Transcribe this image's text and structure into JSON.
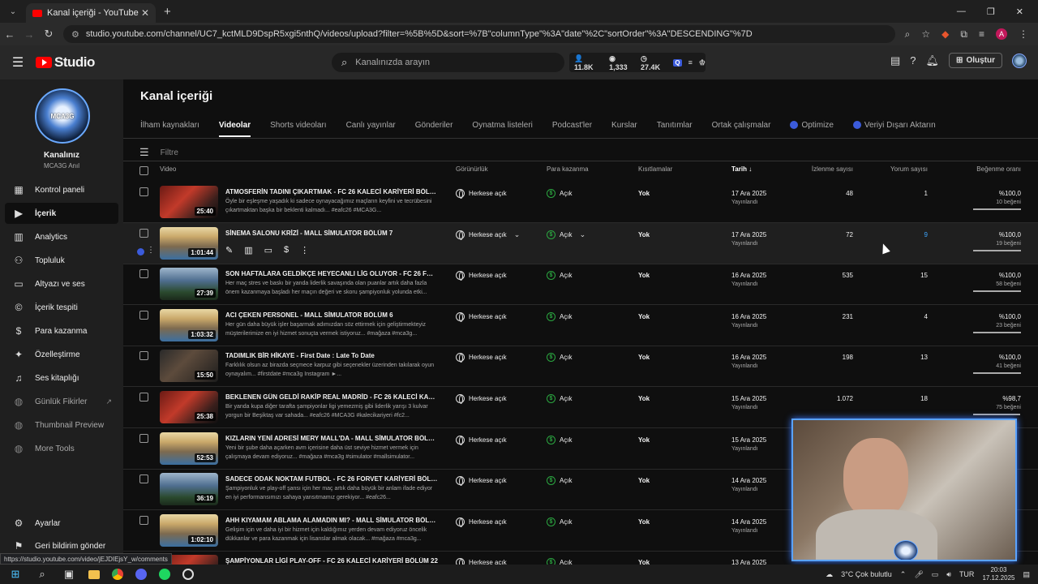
{
  "browser": {
    "tab_title": "Kanal içeriği - YouTube Studio",
    "url": "studio.youtube.com/channel/UC7_kctMLD9DspR5xgi5nthQ/videos/upload?filter=%5B%5D&sort=%7B\"columnType\"%3A\"date\"%2C\"sortOrder\"%3A\"DESCENDING\"%7D",
    "status_url": "https://studio.youtube.com/video/jEJDIEjsY_w/comments",
    "profile_initial": "A"
  },
  "header": {
    "logo_text": "Studio",
    "search_placeholder": "Kanalınızda arayın",
    "stats": {
      "subs": "11.8K",
      "views": "1,333",
      "watch": "27.4K"
    },
    "create_label": "Oluştur"
  },
  "sidebar": {
    "avatar_text": "MCA3G",
    "channel_title": "Kanalınız",
    "channel_name": "MCA3G Anıl",
    "items": [
      {
        "label": "Kontrol paneli",
        "icon": "dashboard-icon"
      },
      {
        "label": "İçerik",
        "icon": "content-icon"
      },
      {
        "label": "Analytics",
        "icon": "analytics-icon"
      },
      {
        "label": "Topluluk",
        "icon": "community-icon"
      },
      {
        "label": "Altyazı ve ses",
        "icon": "subtitles-icon"
      },
      {
        "label": "İçerik tespiti",
        "icon": "copyright-icon"
      },
      {
        "label": "Para kazanma",
        "icon": "dollar-icon"
      },
      {
        "label": "Özelleştirme",
        "icon": "magic-wand-icon"
      },
      {
        "label": "Ses kitaplığı",
        "icon": "audio-library-icon"
      },
      {
        "label": "Günlük Fikirler",
        "icon": "ideas-icon"
      },
      {
        "label": "Thumbnail Preview",
        "icon": "thumbnail-preview-icon"
      },
      {
        "label": "More Tools",
        "icon": "tools-icon"
      },
      {
        "label": "Ayarlar",
        "icon": "gear-icon"
      },
      {
        "label": "Geri bildirim gönder",
        "icon": "feedback-icon"
      }
    ]
  },
  "main": {
    "title": "Kanal içeriği",
    "tabs": [
      "İlham kaynakları",
      "Videolar",
      "Shorts videoları",
      "Canlı yayınlar",
      "Gönderiler",
      "Oynatma listeleri",
      "Podcast'ler",
      "Kurslar",
      "Tanıtımlar",
      "Ortak çalışmalar",
      "Optimize",
      "Veriyi Dışarı Aktarın"
    ],
    "filter_placeholder": "Filtre",
    "columns": {
      "video": "Video",
      "visibility": "Görünürlük",
      "monetization": "Para kazanma",
      "restrictions": "Kısıtlamalar",
      "date": "Tarih",
      "views": "İzlenme sayısı",
      "comments": "Yorum sayısı",
      "likes": "Beğenme oranı"
    },
    "rows": [
      {
        "title": "ATMOSFERİN TADINI ÇIKARTMAK - FC 26 KALECİ KARİYERİ BÖLÜM 24",
        "desc": "Öyle bir eşleşme yaşadık ki sadece oynayacağımız maçların keyfini ve tecrübesini çıkartmaktan başka bir beklenti kalmadı... #eafc26 #MCA3G...",
        "duration": "25:40",
        "visibility": "Herkese açık",
        "monetization": "Açık",
        "restrictions": "Yok",
        "date": "17 Ara 2025",
        "status": "Yayınlandı",
        "views": "48",
        "comments": "1",
        "like_ratio": "%100,0",
        "like_count": "10 beğeni",
        "like_fraction": 1.0,
        "thumb": "football"
      },
      {
        "title": "SİNEMA SALONU KRİZİ - MALL SİMULATOR BÖLÜM 7",
        "desc": "",
        "duration": "1:01:44",
        "visibility": "Herkese açık",
        "monetization": "Açık",
        "restrictions": "Yok",
        "date": "17 Ara 2025",
        "status": "Yayınlandı",
        "views": "72",
        "comments": "9",
        "like_ratio": "%100,0",
        "like_count": "19 beğeni",
        "like_fraction": 1.0,
        "thumb": "mall"
      },
      {
        "title": "SON HAFTALARA GELDİKÇE HEYECANLI LİG OLUYOR - FC 26 FORVET KARİYERİ",
        "desc": "Her maç stres ve baskı bir yanda liderlik savaşında olan puanlar artık daha fazla önem kazanmaya başladı her maçın değeri ve skoru şampiyonluk yolunda etki...",
        "duration": "27:39",
        "visibility": "Herkese açık",
        "monetization": "Açık",
        "restrictions": "Yok",
        "date": "16 Ara 2025",
        "status": "Yayınlandı",
        "views": "535",
        "comments": "15",
        "like_ratio": "%100,0",
        "like_count": "58 beğeni",
        "like_fraction": 1.0,
        "thumb": "stadium"
      },
      {
        "title": "ACI ÇEKEN PERSONEL - MALL SİMULATOR BÖLÜM 6",
        "desc": "Her gün daha büyük işler başarmak adımızdan söz ettirmek için geliştirmekteyiz müşterilerimize en iyi hizmet sonuçta vermek istiyoruz... #mağaza #mca3g...",
        "duration": "1:03:32",
        "visibility": "Herkese açık",
        "monetization": "Açık",
        "restrictions": "Yok",
        "date": "16 Ara 2025",
        "status": "Yayınlandı",
        "views": "231",
        "comments": "4",
        "like_ratio": "%100,0",
        "like_count": "23 beğeni",
        "like_fraction": 1.0,
        "thumb": "mall"
      },
      {
        "title": "TADIMLIK BİR HİKAYE - First Date : Late To Date",
        "desc": "Farklılık olsun az birazda seçmece karpuz gibi seçenekler üzerinden takılarak oyun oynayalım... #firstdate #mca3g Instagram ►...",
        "duration": "15:50",
        "visibility": "Herkese açık",
        "monetization": "Açık",
        "restrictions": "Yok",
        "date": "16 Ara 2025",
        "status": "Yayınlandı",
        "views": "198",
        "comments": "13",
        "like_ratio": "%100,0",
        "like_count": "41 beğeni",
        "like_fraction": 1.0,
        "thumb": "story"
      },
      {
        "title": "BEKLENEN GÜN GELDİ RAKİP REAL MADRİD - FC 26 KALECİ KARİYERİ BÖLÜM",
        "desc": "Bir yanda kupa diğer tarafta şampiyonlar ligi yemezmiş gibi liderlik yarışı 3 kulvar yorgun bir Beşiktaş var sahada... #eafc26 #MCA3G #kalecikariyeri #fc2...",
        "duration": "25:38",
        "visibility": "Herkese açık",
        "monetization": "Açık",
        "restrictions": "Yok",
        "date": "15 Ara 2025",
        "status": "Yayınlandı",
        "views": "1.072",
        "comments": "18",
        "like_ratio": "%98,7",
        "like_count": "75 beğeni",
        "like_fraction": 0.987,
        "thumb": "football"
      },
      {
        "title": "KIZLARIN YENİ ADRESİ MERY MALL'DA - MALL SİMULATOR BÖLÜM 5",
        "desc": "Yeni bir şube daha açarken avm içerisine daha üst seviye hizmet vermek için çalışmaya devam ediyoruz... #mağaza #mca3g #simulator #mallsimulator...",
        "duration": "52:53",
        "visibility": "Herkese açık",
        "monetization": "Açık",
        "restrictions": "Yok",
        "date": "15 Ara 2025",
        "status": "Yayınlandı",
        "views": "",
        "comments": "",
        "like_ratio": "",
        "like_count": "",
        "like_fraction": 0,
        "thumb": "mall"
      },
      {
        "title": "SADECE ODAK NOKTAM FUTBOL - FC 26 FORVET KARİYERİ BÖLÜM 9",
        "desc": "Şampiyonluk ve play-off şansı için her maç artık daha büyük bir anlam ifade ediyor en iyi performansımızı sahaya yansıtmamız gerekiyor... #eafc26...",
        "duration": "36:19",
        "visibility": "Herkese açık",
        "monetization": "Açık",
        "restrictions": "Yok",
        "date": "14 Ara 2025",
        "status": "Yayınlandı",
        "views": "",
        "comments": "",
        "like_ratio": "",
        "like_count": "",
        "like_fraction": 0,
        "thumb": "stadium"
      },
      {
        "title": "AHH KIYAMAM ABLAMA ALAMADIN MI? - MALL SİMULATOR BÖLÜM 4",
        "desc": "Gelişim için ve daha iyi bir hizmet için kaldığımız yerden devam ediyoruz öncelik dükkanlar ve para kazanmak için lisanslar almak olacak... #mağaza #mca3g...",
        "duration": "1:02:10",
        "visibility": "Herkese açık",
        "monetization": "Açık",
        "restrictions": "Yok",
        "date": "14 Ara 2025",
        "status": "Yayınlandı",
        "views": "",
        "comments": "",
        "like_ratio": "",
        "like_count": "",
        "like_fraction": 0,
        "thumb": "mall"
      },
      {
        "title": "ŞAMPİYONLAR LİGİ PLAY-OFF - FC 26 KALECİ KARİYERİ BÖLÜM 22",
        "desc": "",
        "duration": "",
        "visibility": "Herkese açık",
        "monetization": "Açık",
        "restrictions": "Yok",
        "date": "13 Ara 2025",
        "status": "",
        "views": "",
        "comments": "",
        "like_ratio": "",
        "like_count": "",
        "like_fraction": 0,
        "thumb": "football"
      }
    ]
  },
  "taskbar": {
    "weather": "3°C  Çok bulutlu",
    "lang": "TUR",
    "time": "20:03",
    "date": "17.12.2025"
  }
}
